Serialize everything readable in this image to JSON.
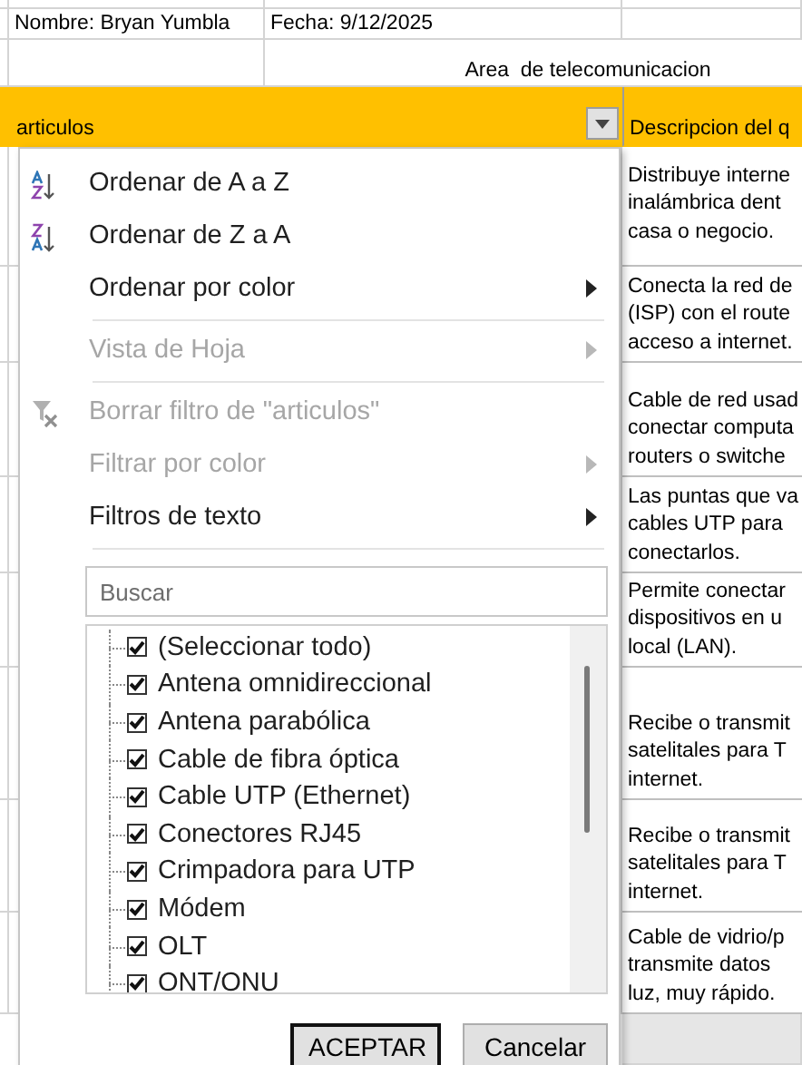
{
  "sheet": {
    "name_cell": "Nombre: Bryan Yumbla",
    "date_cell": "Fecha: 9/12/2025",
    "area_title": "Area  de telecomunicacion",
    "header": {
      "column_1": "articulos",
      "column_2": "Descripcion del q"
    },
    "descriptions": [
      {
        "lines": [
          "Distribuye interne",
          "inalámbrica dent",
          "casa o negocio."
        ]
      },
      {
        "lines": [
          "Conecta la red de",
          "(ISP) con el route",
          "acceso a internet."
        ]
      },
      {
        "lines": [
          "Cable de red usad",
          "conectar computa",
          "routers o switche"
        ]
      },
      {
        "lines": [
          "Las puntas que va",
          "cables UTP para",
          "conectarlos."
        ]
      },
      {
        "lines": [
          "Permite conectar",
          "dispositivos en u",
          "local (LAN)."
        ]
      },
      {
        "lines": [
          "Recibe o transmit",
          "satelitales para T",
          "internet."
        ]
      },
      {
        "lines": [
          "Recibe o transmit",
          "satelitales para T",
          "internet."
        ]
      },
      {
        "lines": [
          "Cable de vidrio/p",
          "transmite datos",
          "luz, muy rápido."
        ]
      }
    ]
  },
  "filter_menu": {
    "items": [
      {
        "kind": "sort-az",
        "label": "Ordenar de A a Z",
        "disabled": false,
        "submenu": false
      },
      {
        "kind": "sort-za",
        "label": "Ordenar de Z a A",
        "disabled": false,
        "submenu": false
      },
      {
        "kind": "plain",
        "label": "Ordenar por color",
        "disabled": false,
        "submenu": true
      },
      {
        "kind": "separator"
      },
      {
        "kind": "plain",
        "label": "Vista de Hoja",
        "disabled": true,
        "submenu": true
      },
      {
        "kind": "separator"
      },
      {
        "kind": "clear-filter",
        "label": "Borrar filtro de \"articulos\"",
        "disabled": true,
        "submenu": false
      },
      {
        "kind": "plain",
        "label": "Filtrar por color",
        "disabled": true,
        "submenu": true
      },
      {
        "kind": "plain",
        "label": "Filtros de texto",
        "disabled": false,
        "submenu": true
      },
      {
        "kind": "separator"
      }
    ],
    "search": {
      "placeholder": "Buscar"
    },
    "values": [
      {
        "label": "(Seleccionar todo)",
        "checked": true
      },
      {
        "label": "Antena omnidireccional",
        "checked": true
      },
      {
        "label": "Antena parabólica",
        "checked": true
      },
      {
        "label": "Cable de fibra óptica",
        "checked": true
      },
      {
        "label": "Cable UTP (Ethernet)",
        "checked": true
      },
      {
        "label": "Conectores RJ45",
        "checked": true
      },
      {
        "label": "Crimpadora para UTP",
        "checked": true
      },
      {
        "label": "Módem",
        "checked": true
      },
      {
        "label": "OLT",
        "checked": true
      },
      {
        "label": "ONT/ONU",
        "checked": true
      }
    ],
    "buttons": [
      {
        "label": "ACEPTAR",
        "default": true
      },
      {
        "label": "Cancelar",
        "default": false
      }
    ]
  }
}
